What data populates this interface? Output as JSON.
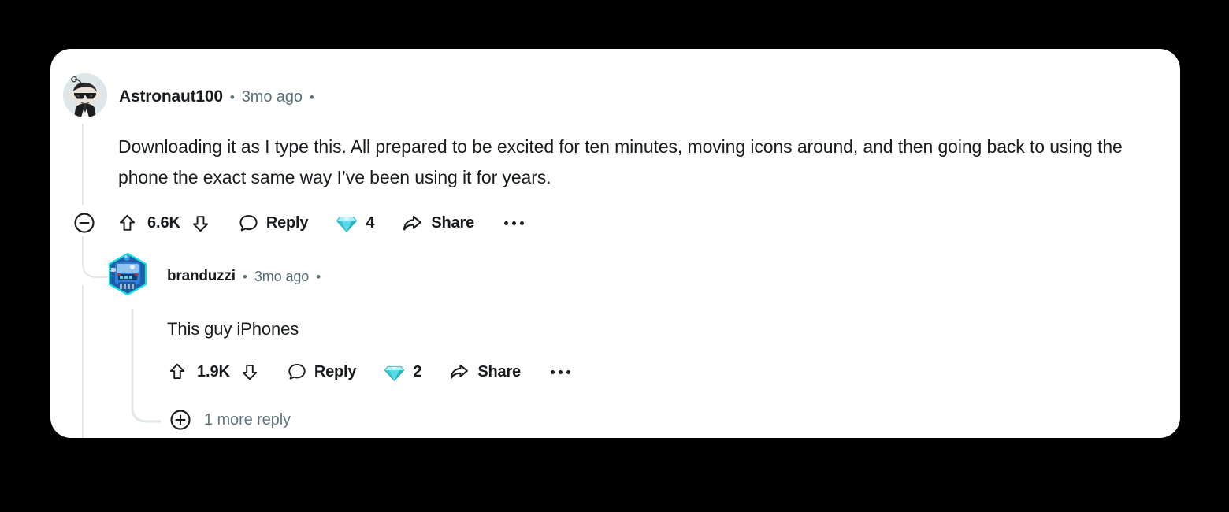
{
  "card": {
    "background": "#ffffff",
    "page_background": "#000000"
  },
  "colors": {
    "text_primary": "#181c1f",
    "text_muted": "#576f76",
    "text_more_replies": "#64777e",
    "thread_line": "#e2e7e9",
    "gem_teal": "#4ad8e0"
  },
  "comments": [
    {
      "id": "root",
      "avatar_name": "snoo-sunglasses-avatar",
      "username": "Astronaut100",
      "separator": "•",
      "timestamp": "3mo ago",
      "trailing_separator": "•",
      "body": "Downloading it as I type this. All prepared to be excited for ten minutes, moving icons around, and then going back to using the phone the exact same way I’ve been using it for years.",
      "actions": {
        "collapse_icon": "minus-circle-icon",
        "upvote_icon": "upvote-arrow-icon",
        "score": "6.6K",
        "downvote_icon": "downvote-arrow-icon",
        "reply_icon": "comment-bubble-icon",
        "reply_label": "Reply",
        "award_icon": "gem-award-icon",
        "award_count": "4",
        "share_icon": "share-arrow-icon",
        "share_label": "Share",
        "overflow_icon": "ellipsis-icon"
      }
    },
    {
      "id": "reply",
      "avatar_name": "robot-nft-avatar",
      "username": "branduzzi",
      "separator": "•",
      "timestamp": "3mo ago",
      "trailing_separator": "•",
      "body": "This guy iPhones",
      "actions": {
        "upvote_icon": "upvote-arrow-icon",
        "score": "1.9K",
        "downvote_icon": "downvote-arrow-icon",
        "reply_icon": "comment-bubble-icon",
        "reply_label": "Reply",
        "award_icon": "gem-award-icon",
        "award_count": "2",
        "share_icon": "share-arrow-icon",
        "share_label": "Share",
        "overflow_icon": "ellipsis-icon"
      }
    }
  ],
  "more_replies": {
    "icon": "plus-circle-icon",
    "label": "1 more reply"
  }
}
